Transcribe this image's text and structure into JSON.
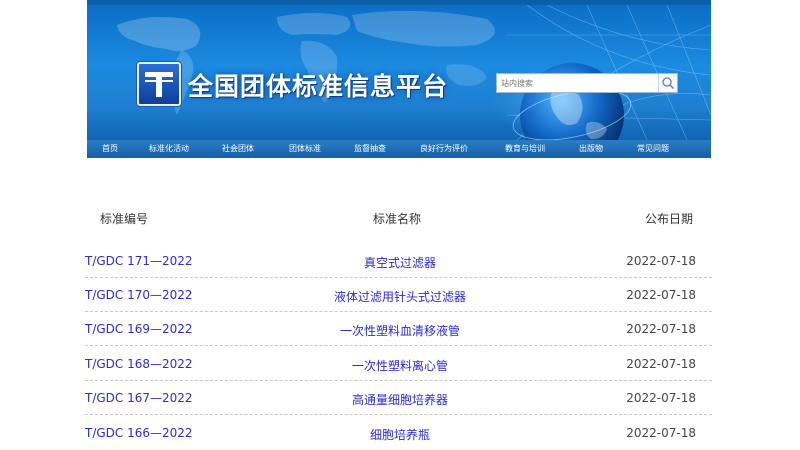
{
  "header": {
    "site_title": "全国团体标准信息平台",
    "search_placeholder": "站内搜索"
  },
  "nav": {
    "items": [
      {
        "label": "首页"
      },
      {
        "label": "标准化活动"
      },
      {
        "label": "社会团体"
      },
      {
        "label": "团体标准"
      },
      {
        "label": "监督抽查"
      },
      {
        "label": "良好行为评价"
      },
      {
        "label": "教育与培训"
      },
      {
        "label": "出版物"
      },
      {
        "label": "常见问题"
      }
    ]
  },
  "table": {
    "headers": {
      "code": "标准编号",
      "name": "标准名称",
      "date": "公布日期"
    },
    "rows": [
      {
        "code": "T/GDC 171—2022",
        "name": "真空式过滤器",
        "date": "2022-07-18"
      },
      {
        "code": "T/GDC 170—2022",
        "name": "液体过滤用针头式过滤器",
        "date": "2022-07-18"
      },
      {
        "code": "T/GDC 169—2022",
        "name": "一次性塑料血清移液管",
        "date": "2022-07-18"
      },
      {
        "code": "T/GDC 168—2022",
        "name": "一次性塑料离心管",
        "date": "2022-07-18"
      },
      {
        "code": "T/GDC 167—2022",
        "name": "高通量细胞培养器",
        "date": "2022-07-18"
      },
      {
        "code": "T/GDC 166—2022",
        "name": "细胞培养瓶",
        "date": "2022-07-18"
      }
    ]
  },
  "colors": {
    "link": "#2b2bd9",
    "nav_bg": "#1b6cb5",
    "banner_bg": "#1a86dc"
  }
}
